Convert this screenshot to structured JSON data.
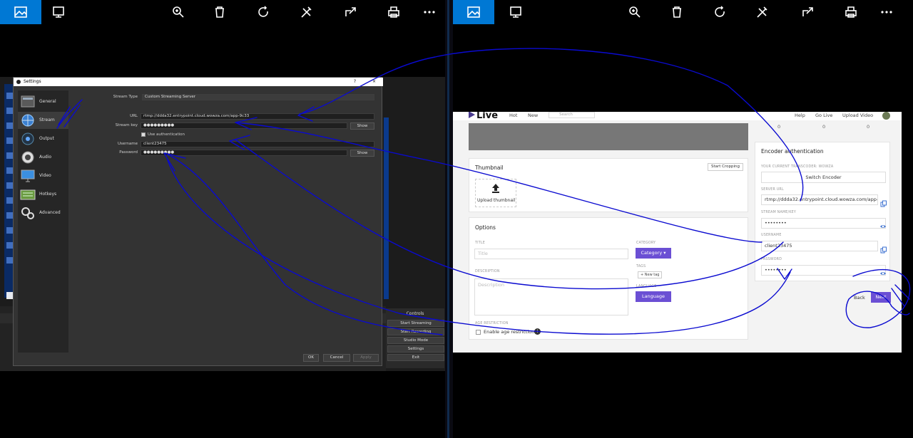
{
  "obs": {
    "title": "Settings",
    "title_help": "?",
    "title_close": "×",
    "sidebar": [
      {
        "label": "General"
      },
      {
        "label": "Stream"
      },
      {
        "label": "Output"
      },
      {
        "label": "Audio"
      },
      {
        "label": "Video"
      },
      {
        "label": "Hotkeys"
      },
      {
        "label": "Advanced"
      }
    ],
    "stream_type_label": "Stream Type",
    "stream_type_value": "Custom Streaming Server",
    "url_label": "URL",
    "url_value": "rtmp://ddda32.entrypoint.cloud.wowza.com/app-9c33",
    "key_label": "Stream key",
    "key_value": "●●●●●●●●●",
    "show_label": "Show",
    "use_auth_label": "Use authentication",
    "username_label": "Username",
    "username_value": "client23475",
    "password_label": "Password",
    "password_value": "●●●●●●●●●",
    "ok": "OK",
    "cancel": "Cancel",
    "apply": "Apply",
    "controls_title": "Controls",
    "controls": [
      "Start Streaming",
      "Start Recording",
      "Studio Mode",
      "Settings",
      "Exit"
    ]
  },
  "live": {
    "brand": "Live",
    "nav": [
      "Hot",
      "New"
    ],
    "search_placeholder": "Search",
    "nav_right": [
      "Help",
      "Go Live",
      "Upload Video"
    ],
    "stats": [
      "0",
      "0",
      "0"
    ],
    "thumbnail_title": "Thumbnail",
    "start_cropping": "Start Cropping",
    "upload_thumbnail": "Upload thumbnail",
    "options_title": "Options",
    "title_label": "TITLE",
    "title_placeholder": "Title",
    "description_label": "DESCRIPTION",
    "description_placeholder": "Description",
    "age_label": "AGE RESTRICTION",
    "age_checkbox": "Enable age restriction",
    "category_label": "CATEGORY",
    "category_button": "Category ▾",
    "tags_label": "TAGS",
    "new_tag": "+ New tag",
    "language_label": "LANGUAGE",
    "language_button": "Language",
    "encoder_title": "Encoder authentication",
    "current_label": "YOUR CURRENT TRANSCODER: WOWZA",
    "switch_encoder": "Switch Encoder",
    "server_url_label": "SERVER URL",
    "server_url_value": "rtmp://ddda32.entrypoint.cloud.wowza.com/app-",
    "stream_key_label": "STREAM NAME/KEY",
    "stream_key_value": "••••••••",
    "username_label": "USERNAME",
    "username_value": "client23475",
    "password_label": "PASSWORD",
    "password_value": "••••••••",
    "back": "Back",
    "next": "Next"
  },
  "colors": {
    "accent": "#0078d4",
    "purple": "#6b4fd4",
    "annotation": "#0a0ad0"
  }
}
